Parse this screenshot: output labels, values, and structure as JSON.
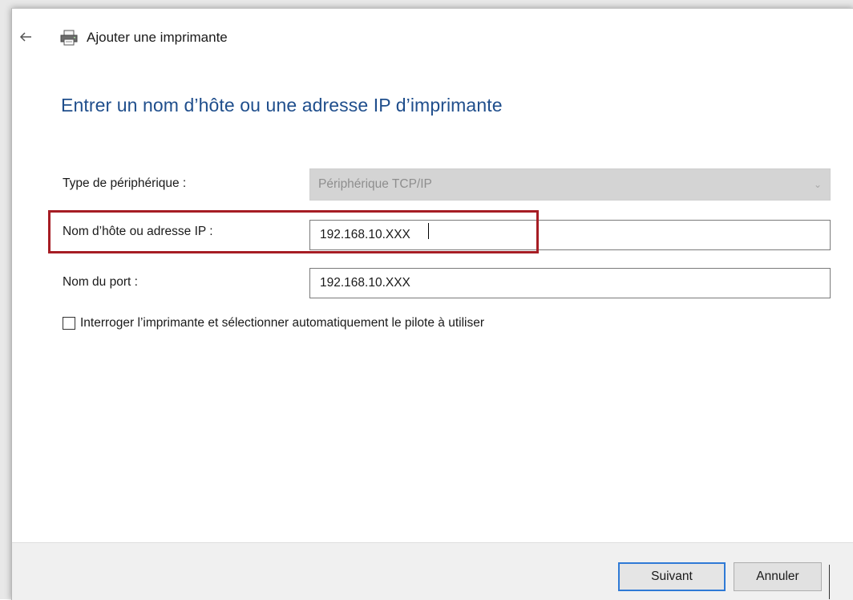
{
  "window": {
    "title": "Ajouter une imprimante",
    "back_icon": "arrow-left-icon",
    "printer_icon": "printer-icon"
  },
  "page": {
    "heading": "Entrer un nom d’hôte ou une adresse IP d’imprimante"
  },
  "form": {
    "device_type_label": "Type de périphérique :",
    "device_type_value": "Périphérique TCP/IP",
    "hostname_label": "Nom d’hôte ou adresse IP :",
    "hostname_value": "192.168.10.XXX",
    "port_label": "Nom du port :",
    "port_value": "192.168.10.XXX",
    "query_checkbox_label": "Interroger l’imprimante et sélectionner automatiquement le pilote à utiliser",
    "query_checkbox_checked": false
  },
  "footer": {
    "next_label": "Suivant",
    "cancel_label": "Annuler"
  },
  "colors": {
    "heading": "#1f4e8c",
    "highlight": "#a61d24",
    "primary_border": "#2f7ad6"
  }
}
